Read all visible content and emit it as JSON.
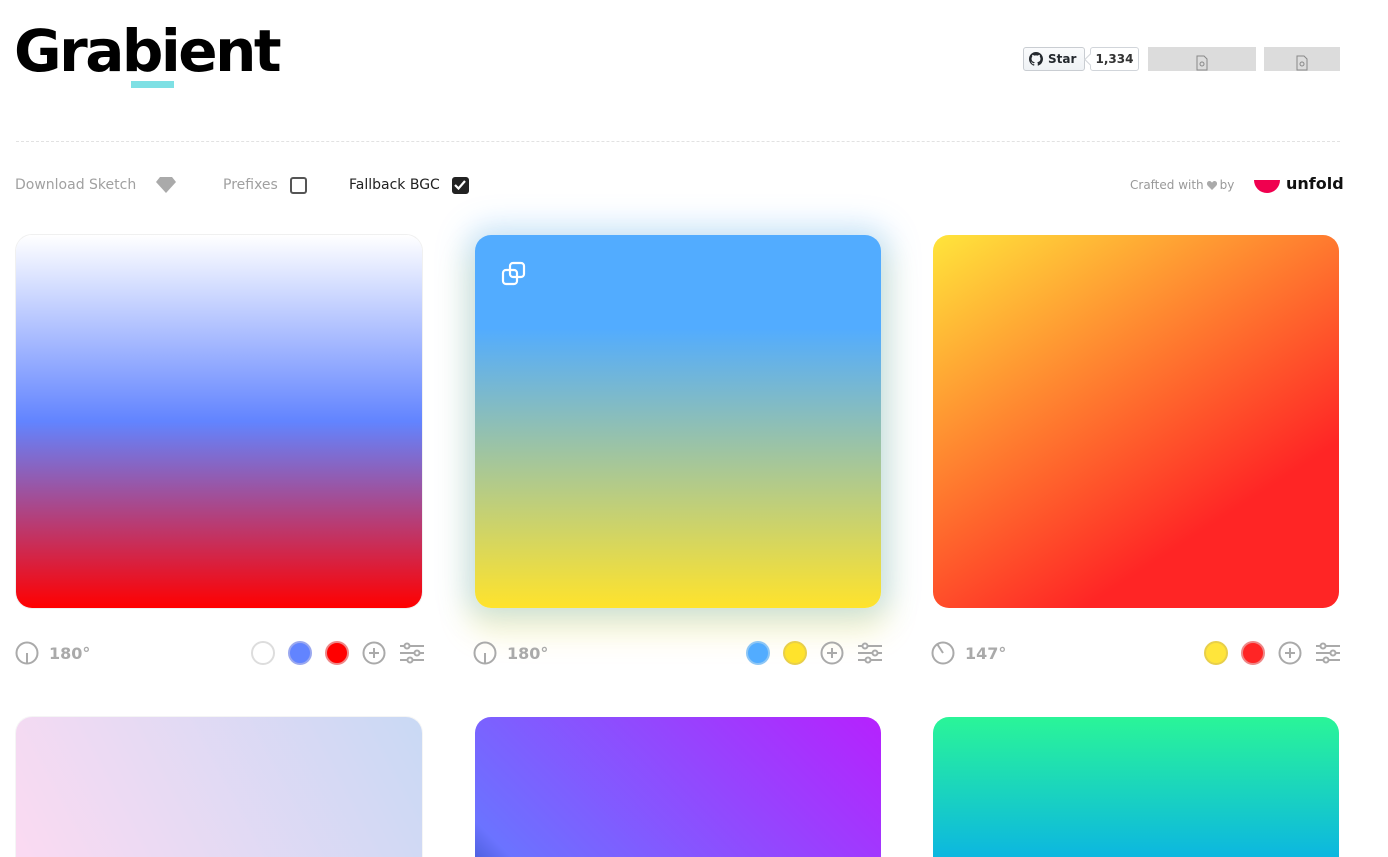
{
  "header": {
    "logo": "Grabient",
    "github_star_label": "Star",
    "github_star_count": "1,334"
  },
  "toolbar": {
    "download_sketch": "Download Sketch",
    "prefixes_label": "Prefixes",
    "prefixes_checked": false,
    "fallback_label": "Fallback BGC",
    "fallback_checked": true,
    "crafted_with": "Crafted with",
    "crafted_by": "by",
    "brand": "unfold"
  },
  "gradients": [
    {
      "angle": "180°",
      "stops": [
        "#ffffff",
        "#6284ff",
        "#ff0000"
      ]
    },
    {
      "angle": "180°",
      "stops": [
        "#52acff",
        "#ffe32c"
      ]
    },
    {
      "angle": "147°",
      "stops": [
        "#ffe53b",
        "#ff2525"
      ]
    }
  ],
  "colors": {
    "accent_underline": "#7ee0e4",
    "brand_mark": "#f0004f"
  }
}
